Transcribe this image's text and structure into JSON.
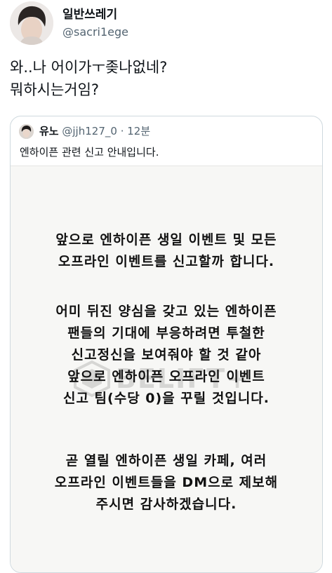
{
  "tweet": {
    "author": {
      "display_name": "일반쓰레기",
      "handle": "@sacri1ege"
    },
    "text_lines": [
      "와..나 어이가ㅜ좆나없네?",
      "뭐하시는거임?"
    ]
  },
  "quote": {
    "author_name": "유노",
    "handle": "@jjh127_0",
    "separator": "·",
    "time": "12분",
    "text": "엔하이픈 관련 신고 안내입니다.",
    "image": {
      "paragraph1": [
        "앞으로 엔하이픈 생일 이벤트 및 모든",
        "오프라인 이벤트를 신고할까 합니다."
      ],
      "paragraph2": [
        "어미 뒤진 양심을 갖고 있는 엔하이픈",
        "팬들의 기대에 부응하려면 투철한",
        "신고정신을 보여줘야 할 것 같아",
        "앞으로 엔하이픈 오프라인 이벤트",
        "신고 팀(수당 0)을 꾸릴 것입니다."
      ],
      "paragraph3": [
        "곧 열릴 엔하이픈 생일 카페, 여러",
        "오프라인 이벤트들을 DM으로 제보해",
        "주시면 감사하겠습니다."
      ],
      "watermark": "BELIFT+"
    }
  }
}
